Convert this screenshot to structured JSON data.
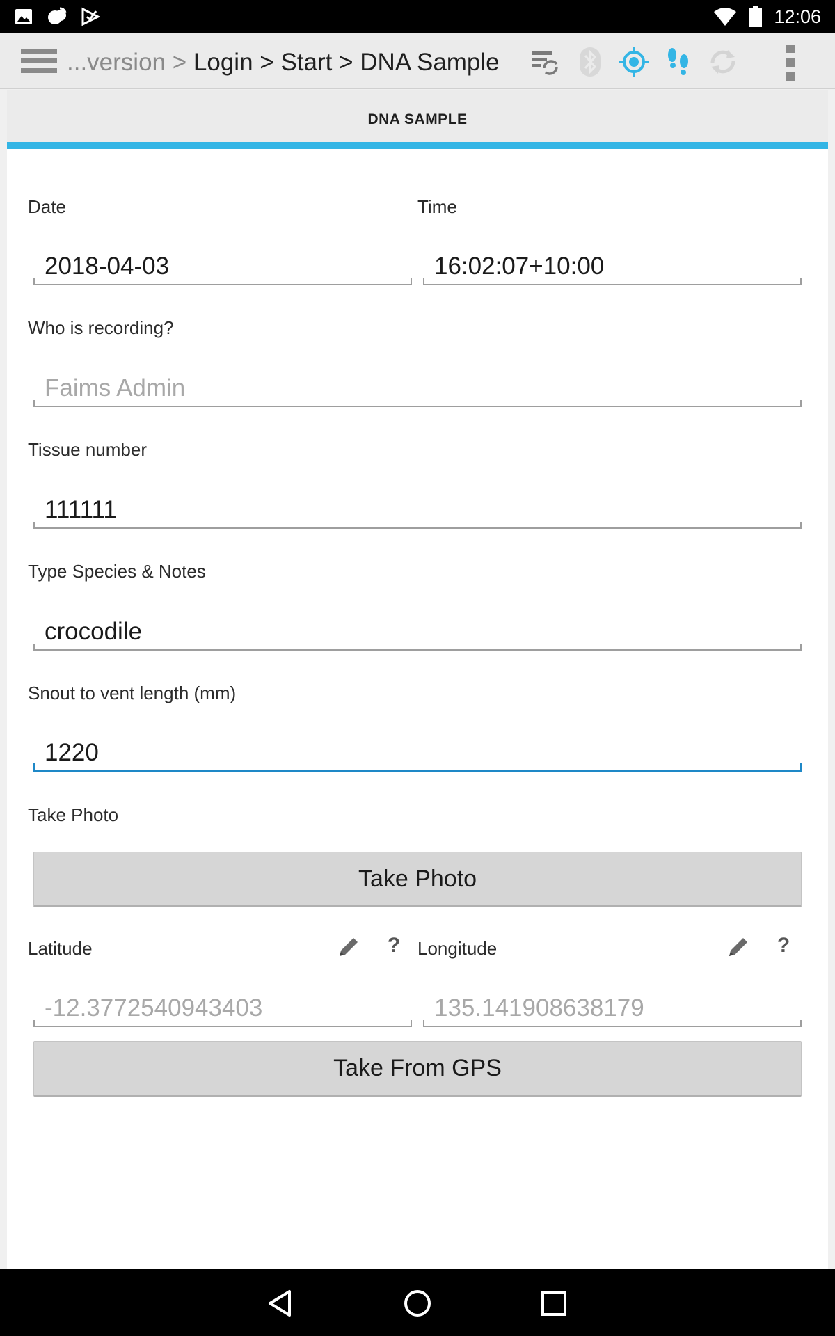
{
  "status_bar": {
    "time": "12:06",
    "left_icons": [
      "image-icon",
      "cloud-icon",
      "play-store-icon"
    ],
    "right_icons": [
      "wifi-icon",
      "battery-icon"
    ]
  },
  "action_bar": {
    "breadcrumb": {
      "truncated": "...version",
      "separator": ">",
      "items": [
        "Login",
        "Start",
        "DNA Sample"
      ]
    },
    "icons": [
      "sync-status-icon",
      "bluetooth-icon",
      "gps-icon",
      "tracking-icon",
      "refresh-icon",
      "overflow-menu-icon"
    ],
    "accent_color": "#33b5e5"
  },
  "tab": {
    "label": "DNA SAMPLE"
  },
  "form": {
    "date": {
      "label": "Date",
      "value": "2018-04-03"
    },
    "time": {
      "label": "Time",
      "value": "16:02:07+10:00"
    },
    "recorder": {
      "label": "Who is recording?",
      "value": "Faims Admin"
    },
    "tissue": {
      "label": "Tissue number",
      "value": "111111"
    },
    "species": {
      "label": "Type Species & Notes",
      "value": "crocodile"
    },
    "snout": {
      "label": "Snout to vent length (mm)",
      "value": "1220"
    },
    "photo": {
      "label": "Take Photo",
      "button_label": "Take Photo"
    },
    "latitude": {
      "label": "Latitude",
      "value": "-12.3772540943403",
      "help": "?"
    },
    "longitude": {
      "label": "Longitude",
      "value": "135.141908638179",
      "help": "?"
    },
    "gps_button_label": "Take From GPS"
  },
  "nav_bar": {
    "icons": [
      "back-icon",
      "home-icon",
      "recents-icon"
    ]
  }
}
